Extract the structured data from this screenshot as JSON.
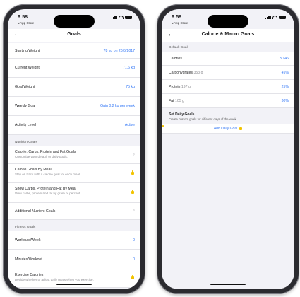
{
  "status": {
    "time": "6:58",
    "back_app": "◂ App Store"
  },
  "left": {
    "title": "Goals",
    "goals_rows": [
      {
        "label": "Starting Weight",
        "value": "78 kg on 20/5/2017"
      },
      {
        "label": "Current Weight",
        "value": "71.6 kg"
      },
      {
        "label": "Goal Weight",
        "value": "75 kg"
      },
      {
        "label": "Weekly Goal",
        "value": "Gain 0.2 kg per week"
      },
      {
        "label": "Activity Level",
        "value": "Active"
      }
    ],
    "nutrition_header": "Nutrition Goals",
    "nutrition_rows": [
      {
        "label": "Calorie, Carbs, Protein and Fat Goals",
        "sub": "Customize your default or daily goals."
      },
      {
        "label": "Calorie Goals By Meal",
        "sub": "Stay on track with a calorie goal for each meal."
      },
      {
        "label": "Show Carbs, Protein and Fat By Meal",
        "sub": "View carbs, protein and fat by gram or percent."
      },
      {
        "label": "Additional Nutrient Goals",
        "sub": ""
      }
    ],
    "fitness_header": "Fitness Goals",
    "fitness_rows": [
      {
        "label": "Workouts/Week",
        "value": "0"
      },
      {
        "label": "Minutes/Workout",
        "value": "0"
      }
    ],
    "exercise": {
      "label": "Exercise Calories",
      "sub": "Decide whether to adjust daily goals when you exercise."
    }
  },
  "right": {
    "title": "Calorie & Macro Goals",
    "default_header": "Default Goal",
    "rows": [
      {
        "label": "Calories",
        "extra": "",
        "value": "3,146"
      },
      {
        "label": "Carbohydrates",
        "extra": "353 g",
        "value": "45%"
      },
      {
        "label": "Protein",
        "extra": "197 g",
        "value": "25%"
      },
      {
        "label": "Fat",
        "extra": "105 g",
        "value": "30%"
      }
    ],
    "set_daily_title": "Set Daily Goals",
    "set_daily_desc": "Create custom goals for different days of the week",
    "add_daily_goal": "Add Daily Goal"
  }
}
